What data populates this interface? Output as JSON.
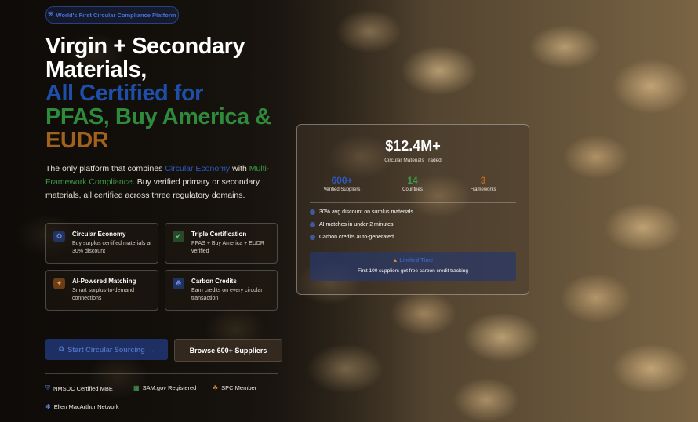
{
  "badge": {
    "icon": "shield-icon",
    "text": "World's First Circular Compliance Platform"
  },
  "headline": {
    "line1": "Virgin + Secondary",
    "line2": "Materials,",
    "line3": "All Certified for",
    "line4": "PFAS, Buy America &",
    "line5": "EUDR"
  },
  "description": {
    "part1": "The only platform that combines ",
    "highlight1": "Circular Economy",
    "part2": " with ",
    "highlight2": "Multi-Framework Compliance",
    "part3": ". Buy verified primary or secondary materials, all certified across three regulatory domains."
  },
  "features": [
    {
      "icon": "recycle-icon",
      "title": "Circular Economy",
      "desc": "Buy surplus certified materials at 30% discount"
    },
    {
      "icon": "shield-check-icon",
      "title": "Triple Certification",
      "desc": "PFAS + Buy America + EUDR verified"
    },
    {
      "icon": "sparkle-icon",
      "title": "AI-Powered Matching",
      "desc": "Smart surplus-to-demand connections"
    },
    {
      "icon": "leaf-icon",
      "title": "Carbon Credits",
      "desc": "Earn credits on every circular transaction"
    }
  ],
  "buttons": {
    "primary": "Start Circular Sourcing",
    "primary_arrow": "→",
    "secondary": "Browse 600+ Suppliers"
  },
  "trust": [
    {
      "icon": "shield-icon",
      "label": "NMSDC Certified MBE"
    },
    {
      "icon": "building-icon",
      "label": "SAM.gov Registered"
    },
    {
      "icon": "leaf-icon",
      "label": "SPC Member"
    },
    {
      "icon": "globe-icon",
      "label": "Ellen MacArthur Network"
    }
  ],
  "card": {
    "big_value": "$12.4M+",
    "big_label": "Circular Materials Traded",
    "stats": [
      {
        "value": "600+",
        "label": "Verified Suppliers",
        "color": "#2d5bc0"
      },
      {
        "value": "14",
        "label": "Countries",
        "color": "#3c9a45"
      },
      {
        "value": "3",
        "label": "Frameworks",
        "color": "#c0651e"
      }
    ],
    "bullets": [
      "30% avg discount on surplus materials",
      "AI matches in under 2 minutes",
      "Carbon credits auto-generated"
    ],
    "cta_title": "Limited Time",
    "cta_sub": "First 100 suppliers get free carbon credit tracking"
  },
  "colors": {
    "blue": "#1e4fa8",
    "green": "#2f8a3b",
    "brown": "#a0621c"
  }
}
